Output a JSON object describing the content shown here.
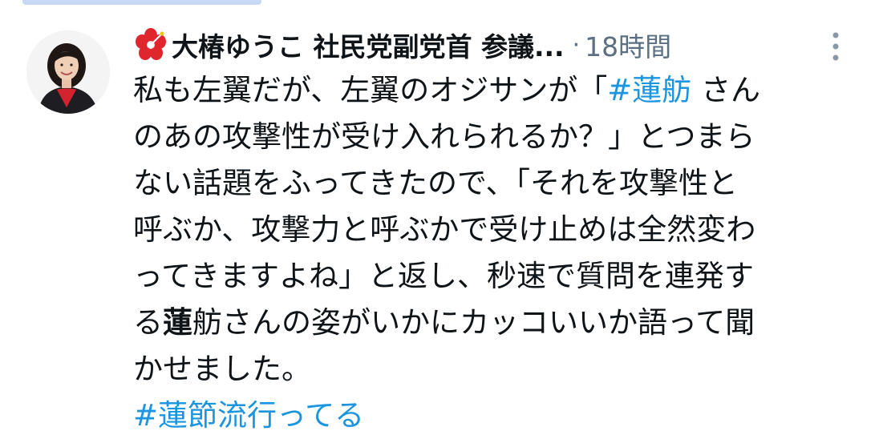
{
  "author": {
    "display_name": "大椿ゆうこ 社民党副党首 参議...",
    "separator": "·",
    "time": "18時間"
  },
  "tweet": {
    "lines": [
      {
        "pre": "私も左翼だが、左翼のオジサンが「",
        "tag": "#蓮舫",
        "post": " さん"
      },
      {
        "text": "のあの攻撃性が受け入れられるか？」とつまら"
      },
      {
        "text": "ない話題をふってきたので、「それを攻撃性と"
      },
      {
        "text": "呼ぶか、攻撃力と呼ぶかで受け止めは全然変わ"
      },
      {
        "text": "ってきますよね」と返し、秒速で質問を連発す"
      },
      {
        "pre": "る",
        "bold": "蓮",
        "post": "舫さんの姿がいかにカッコいいか語って聞"
      },
      {
        "text": "かせました。"
      }
    ],
    "hashtag": "#蓮節流行ってる"
  },
  "colors": {
    "hashtag": "#1b95e0",
    "secondary_text": "#5b7083",
    "flower": "#e0262d"
  },
  "icons": {
    "name_emoji": "hibiscus-icon",
    "menu": "more-vertical-icon"
  }
}
